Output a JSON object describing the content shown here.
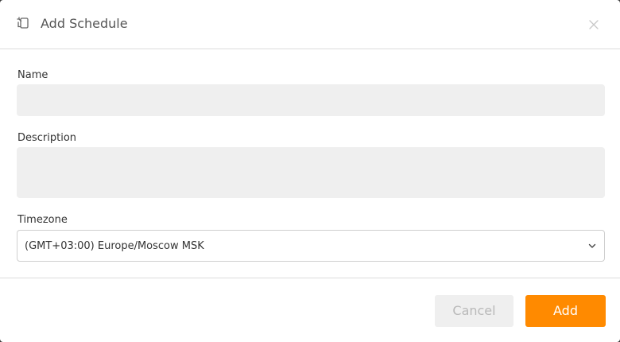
{
  "dialog": {
    "title": "Add Schedule",
    "title_icon": "schedule-icon",
    "close_icon": "close-icon"
  },
  "form": {
    "name": {
      "label": "Name",
      "value": "",
      "placeholder": ""
    },
    "description": {
      "label": "Description",
      "value": "",
      "placeholder": ""
    },
    "timezone": {
      "label": "Timezone",
      "selected": "(GMT+03:00) Europe/Moscow MSK",
      "icon": "chevron-down-icon"
    }
  },
  "footer": {
    "cancel_label": "Cancel",
    "add_label": "Add"
  },
  "colors": {
    "accent": "#ff8a00",
    "field_bg": "#efefef",
    "cancel_text": "#b9b9b9"
  }
}
